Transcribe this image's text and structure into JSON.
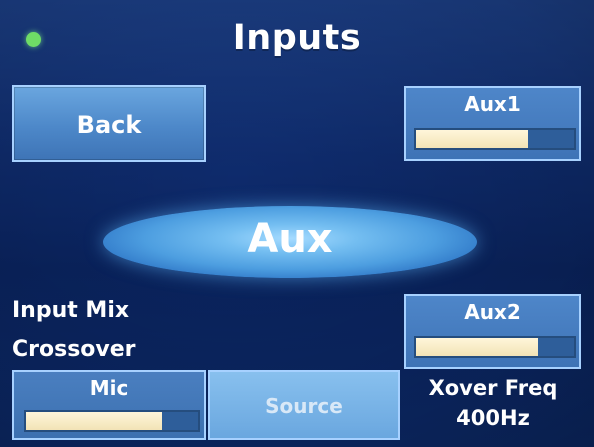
{
  "header": {
    "title": "Inputs",
    "status_led_color": "#6fdc66"
  },
  "buttons": {
    "back_label": "Back",
    "source_label": "Source"
  },
  "mode": {
    "label": "Aux"
  },
  "meters": {
    "aux1": {
      "label": "Aux1",
      "level": 0.71
    },
    "aux2": {
      "label": "Aux2",
      "level": 0.77
    },
    "mic": {
      "label": "Mic",
      "level": 0.79
    }
  },
  "side_labels": {
    "line1": "Input Mix",
    "line2": "Crossover"
  },
  "xover": {
    "label": "Xover Freq",
    "value": "400Hz"
  },
  "colors": {
    "background": "#0f2c6e",
    "button": "#5b93d3",
    "meter_fill": "#f7ebc6"
  }
}
